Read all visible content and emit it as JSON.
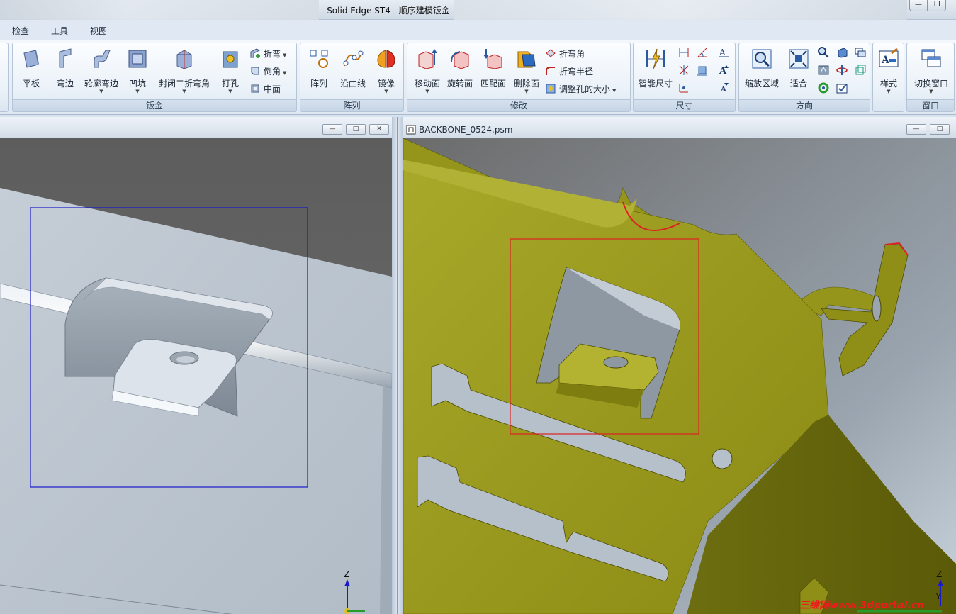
{
  "app": {
    "title": "Solid Edge ST4 - 顺序建模钣金"
  },
  "window_controls": {
    "minimize": "—",
    "restore": "❐"
  },
  "menu": [
    "检查",
    "工具",
    "视图"
  ],
  "ribbon": {
    "groups": {
      "sheetmetal": {
        "label": "钣金",
        "buttons": [
          "平板",
          "弯边",
          "轮廓弯边",
          "凹坑",
          "封闭二折弯角",
          "打孔"
        ],
        "small": [
          "折弯",
          "倒角",
          "中面"
        ]
      },
      "pattern": {
        "label": "阵列",
        "buttons": [
          "阵列",
          "沿曲线",
          "镜像"
        ]
      },
      "modify": {
        "label": "修改",
        "buttons": [
          "移动面",
          "旋转面",
          "匹配面",
          "删除面"
        ],
        "small": [
          "折弯角",
          "折弯半径",
          "调整孔的大小"
        ]
      },
      "dimension": {
        "label": "尺寸",
        "buttons": [
          "智能尺寸"
        ]
      },
      "orient": {
        "label": "方向",
        "buttons": [
          "缩放区域",
          "适合"
        ]
      },
      "style": {
        "buttons": [
          "样式"
        ]
      },
      "window": {
        "label": "窗口",
        "buttons": [
          "切换窗口"
        ]
      }
    },
    "dropdown_arrow": "▼"
  },
  "documents": {
    "left": {
      "title": "",
      "controls": [
        "—",
        "□",
        "✕"
      ]
    },
    "right": {
      "title": "BACKBONE_0524.psm",
      "controls": [
        "—",
        "□"
      ]
    }
  },
  "triad": {
    "z": "Z",
    "y": "Y"
  },
  "watermark": "三维网www.3dportal.cn",
  "colors": {
    "part_left": "#b6c1cc",
    "part_right": "#a3a31a",
    "selection_left": "#1a1acc",
    "selection_right": "#dd2222",
    "background_top": "#606060"
  }
}
